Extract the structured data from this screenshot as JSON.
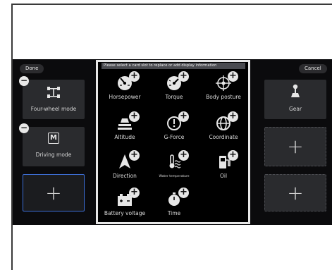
{
  "header": {
    "done_label": "Done",
    "cancel_label": "Cancel"
  },
  "left_cards": [
    {
      "label": "Four-wheel mode",
      "icon": "four-wheel-icon"
    },
    {
      "label": "Driving mode",
      "icon": "driving-mode-icon",
      "glyph": "M"
    }
  ],
  "right_cards": [
    {
      "label": "Gear",
      "icon": "gear-shifter-icon"
    }
  ],
  "add_glyph": "+",
  "remove_glyph": "−",
  "panel": {
    "hint": "Please select a card slot to replace or add display information",
    "items": [
      {
        "label": "Horsepower",
        "icon": "horsepower-gauge-icon"
      },
      {
        "label": "Torque",
        "icon": "torque-gauge-icon"
      },
      {
        "label": "Body posture",
        "icon": "body-posture-icon"
      },
      {
        "label": "Altitude",
        "icon": "altitude-icon"
      },
      {
        "label": "G-Force",
        "icon": "g-force-icon"
      },
      {
        "label": "Coordinate",
        "icon": "coordinate-globe-icon"
      },
      {
        "label": "Direction",
        "icon": "direction-arrow-icon"
      },
      {
        "label": "Water temperature",
        "icon": "water-temperature-icon"
      },
      {
        "label": "Oil",
        "icon": "fuel-pump-icon"
      },
      {
        "label": "Battery voltage",
        "icon": "battery-icon"
      },
      {
        "label": "Time",
        "icon": "stopwatch-icon"
      }
    ]
  },
  "colors": {
    "screen_bg": "#0b0b0d",
    "card_bg": "#2a2b2e",
    "selected_border": "#3d6fd6",
    "panel_border": "#e8e8e8"
  }
}
